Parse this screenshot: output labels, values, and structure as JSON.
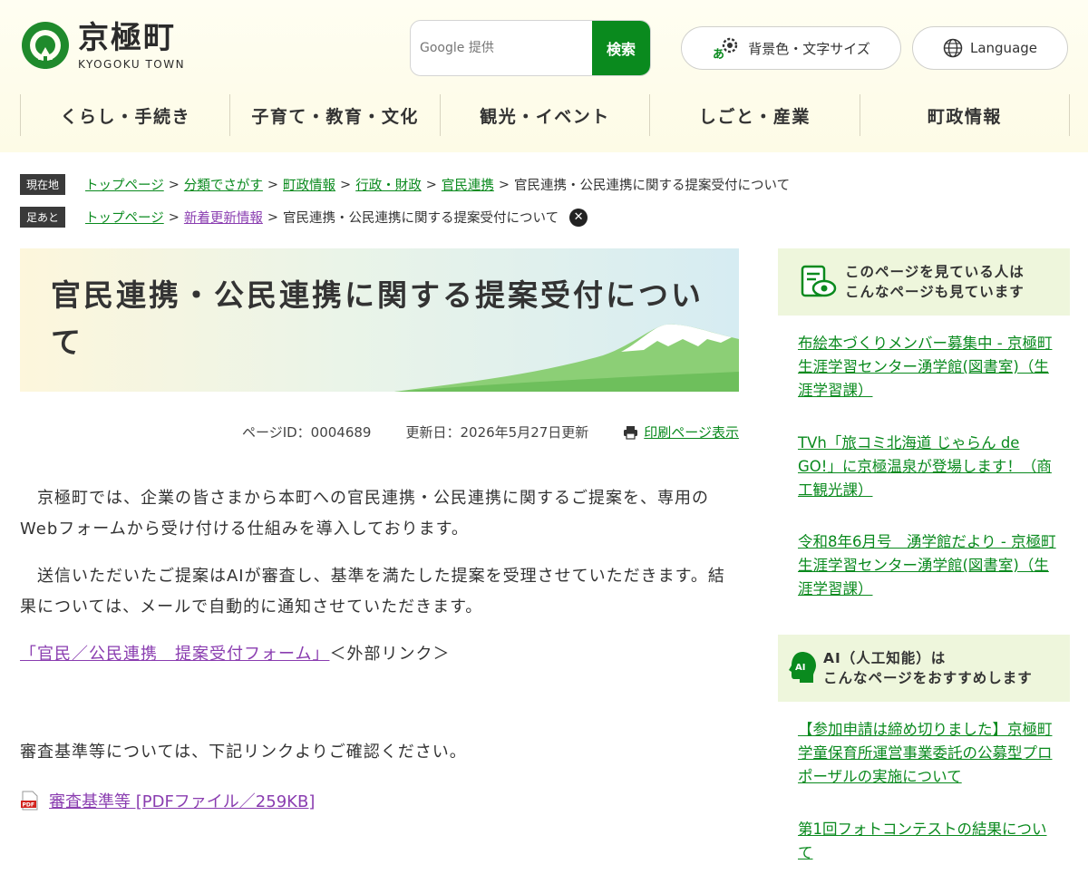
{
  "header": {
    "logo_name": "京極町",
    "logo_sub": "KYOGOKU TOWN",
    "search_placeholder": "Google 提供",
    "search_button": "検索",
    "accessibility_button": "背景色・文字サイズ",
    "language_button": "Language"
  },
  "gnav": [
    "くらし・手続き",
    "子育て・教育・文化",
    "観光・イベント",
    "しごと・産業",
    "町政情報"
  ],
  "breadcrumb": {
    "tag": "現在地",
    "links": [
      "トップページ",
      "分類でさがす",
      "町政情報",
      "行政・財政",
      "官民連携"
    ],
    "current": "官民連携・公民連携に関する提案受付について"
  },
  "history": {
    "tag": "足あと",
    "links": [
      "トップページ",
      "新着更新情報"
    ],
    "current": "官民連携・公民連携に関する提案受付について"
  },
  "page": {
    "title": "官民連携・公民連携に関する提案受付について",
    "page_id": "ページID：0004689",
    "updated": "更新日：2026年5月27日更新",
    "print": "印刷ページ表示",
    "para1": "　京極町では、企業の皆さまから本町への官民連携・公民連携に関するご提案を、専用のWebフォームから受け付ける仕組みを導入しております。",
    "para2": "　送信いただいたご提案はAIが審査し、基準を満たした提案を受理させていただきます。結果については、メールで自動的に通知させていただきます。",
    "form_link": "「官民／公民連携　提案受付フォーム」",
    "external": "＜外部リンク＞",
    "para3": "審査基準等については、下記リンクよりご確認ください。",
    "pdf_link": "審査基準等 [PDFファイル／259KB]"
  },
  "sidebar": {
    "viewed_heading_1": "このページを見ている人は",
    "viewed_heading_2": "こんなページも見ています",
    "viewed": [
      "布絵本づくりメンバー募集中 - 京極町生涯学習センター湧学館(図書室)（生涯学習課）",
      "TVh「旅コミ北海道 じゃらん de GO!」に京極温泉が登場します！（商工観光課）",
      "令和8年6月号　湧学館だより - 京極町生涯学習センター湧学館(図書室)（生涯学習課）"
    ],
    "ai_heading_1": "AI（人工知能）は",
    "ai_heading_2": "こんなページをおすすめします",
    "ai_badge": "AI",
    "ai": [
      "【参加申請は締め切りました】京極町学童保育所運営事業委託の公募型プロポーザルの実施について",
      "第1回フォトコンテストの結果について"
    ]
  },
  "colors": {
    "accent_green": "#0a8a1e",
    "visited_purple": "#8a3db0",
    "sidebar_bg": "#eef6dc"
  }
}
